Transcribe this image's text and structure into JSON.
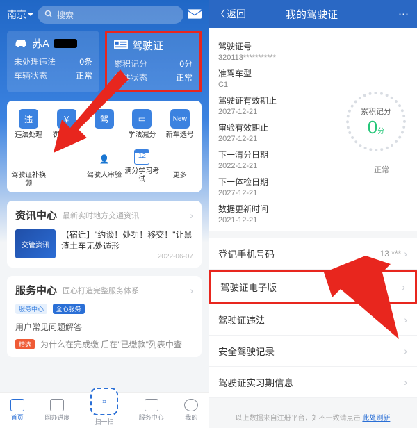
{
  "left": {
    "city": "南京",
    "search_placeholder": "搜索",
    "cards": {
      "vehicle": {
        "title_prefix": "苏A",
        "row1_label": "未处理违法",
        "row1_value": "0条",
        "row2_label": "车辆状态",
        "row2_value": "正常"
      },
      "license": {
        "title": "驾驶证",
        "row1_label": "累积记分",
        "row1_value": "0分",
        "row2_label": "证件状态",
        "row2_value": "正常"
      }
    },
    "grid": [
      "违法处理",
      "罚款缴纳",
      "",
      "学法减分",
      "新车选号",
      "驾驶证补换领",
      "",
      "驾驶人审验",
      "满分学习考试",
      "更多"
    ],
    "grid_badge": "12",
    "news_section": {
      "title": "资讯中心",
      "sub": "最新实时地方交通资讯"
    },
    "news_thumb": "交管资讯",
    "news_item": "【宿迁】\"约谈！处罚！移交！\"让黑渣土车无处遁形",
    "news_date": "2022-06-07",
    "service_section": {
      "title": "服务中心",
      "sub": "匠心打造完整服务体系"
    },
    "service_tag1": "服务中心",
    "service_tag2": "全心服务",
    "faq": "用户常见问题解答",
    "bottom_line": "为什么在完成缴    后在\"已缴款\"列表中查",
    "bottom_tag": "精选",
    "tabs": [
      "首页",
      "网办进度",
      "扫一扫",
      "服务中心",
      "我的"
    ]
  },
  "right": {
    "back": "返回",
    "title": "我的驾驶证",
    "fields": {
      "f1l": "驾驶证号",
      "f1v": "320113***********",
      "f2l": "准驾车型",
      "f2v": "C1",
      "f3l": "驾驶证有效期止",
      "f3v": "2027-12-21",
      "f4l": "审验有效期止",
      "f4v": "2027-12-21",
      "f5l": "下一清分日期",
      "f5v": "2022-12-21",
      "f6l": "下一体检日期",
      "f6v": "2027-12-21",
      "f7l": "数据更新时间",
      "f7v": "2021-12-21"
    },
    "gauge_label": "累积记分",
    "gauge_value": "0",
    "gauge_unit": "分",
    "gauge_status": "正常",
    "list": {
      "l1": "登记手机号码",
      "l1v": "13     ***",
      "l2": "驾驶证电子版",
      "l3": "驾驶证违法",
      "l4": "安全驾驶记录",
      "l5": "驾驶证实习期信息"
    },
    "footer_a": "以上数据来自注册平台，如不一致请点击",
    "footer_b": "此处刷新"
  }
}
